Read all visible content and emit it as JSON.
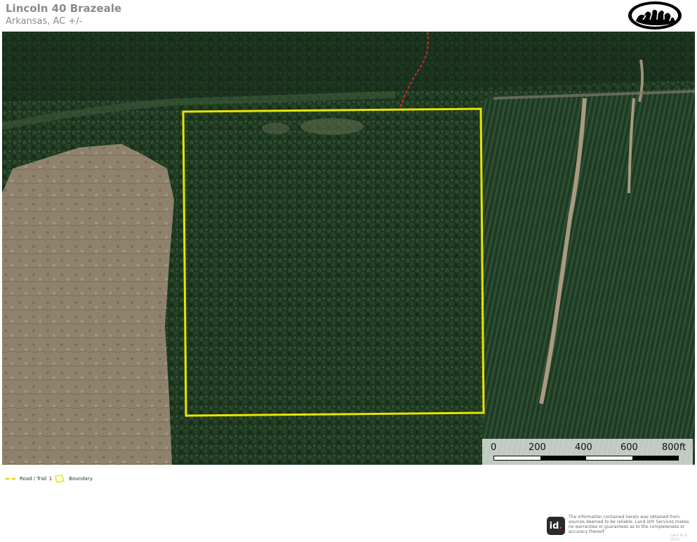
{
  "header": {
    "title": "Lincoln 40 Brazeale",
    "subtitle": "Arkansas,  AC +/-"
  },
  "logo": {
    "icon": "bear-paw-icon"
  },
  "map": {
    "imagery": "aerial-satellite",
    "features": [
      "forest",
      "clearcut-field",
      "pine-plantation",
      "dirt-road",
      "red-trail"
    ]
  },
  "scale": {
    "labels": [
      "0",
      "200",
      "400",
      "600",
      "800ft"
    ]
  },
  "legend": {
    "road_label": "Road / Trail",
    "road_suffix": "1",
    "boundary_label": "Boundary",
    "road_color": "#e3c800",
    "boundary_color": "#e8e400"
  },
  "footer": {
    "badge_text": "id",
    "disclaimer": "The information contained herein was obtained from sources deemed to be reliable. Land id® Services makes no warranties or guarantees as to the completeness or accuracy thereof.",
    "copyright": "Land id © 2023"
  }
}
